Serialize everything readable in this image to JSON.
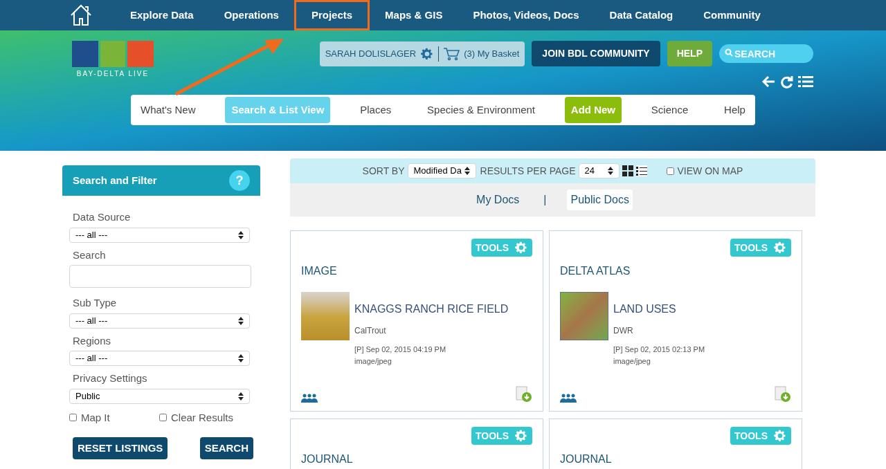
{
  "top_nav": {
    "items": [
      {
        "label": "Explore Data",
        "highlighted": false
      },
      {
        "label": "Operations",
        "highlighted": false
      },
      {
        "label": "Projects",
        "highlighted": true
      },
      {
        "label": "Maps & GIS",
        "highlighted": false
      },
      {
        "label": "Photos, Videos, Docs",
        "highlighted": false
      },
      {
        "label": "Data Catalog",
        "highlighted": false
      },
      {
        "label": "Community",
        "highlighted": false
      }
    ]
  },
  "logo": {
    "text": "BAY-DELTA LIVE"
  },
  "user_bar": {
    "user": "SARAH DOLISLAGER",
    "basket": "(3) My Basket"
  },
  "join_button": "JOIN BDL COMMUNITY",
  "help_button": "HELP",
  "search": {
    "placeholder": "SEARCH"
  },
  "sub_nav": {
    "items": [
      {
        "label": "What's New",
        "kind": "tab",
        "selected": false
      },
      {
        "label": "Search & List View",
        "kind": "tab",
        "selected": true
      },
      {
        "label": "Places",
        "kind": "tab",
        "selected": false
      },
      {
        "label": "Species & Environment",
        "kind": "tab",
        "selected": false
      },
      {
        "label": "Add New",
        "kind": "action",
        "selected": false
      },
      {
        "label": "Science",
        "kind": "tab",
        "selected": false
      },
      {
        "label": "Help",
        "kind": "tab",
        "selected": false
      }
    ]
  },
  "sidebar": {
    "title": "Search and Filter",
    "help": "?",
    "fields": [
      {
        "label": "Data Source",
        "kind": "select",
        "value": "--- all ---"
      },
      {
        "label": "Search",
        "kind": "text"
      },
      {
        "label": "Sub Type",
        "kind": "select",
        "value": "--- all ---"
      },
      {
        "label": "Regions",
        "kind": "select",
        "value": "--- all ---"
      },
      {
        "label": "Privacy Settings",
        "kind": "select",
        "value": "Public"
      }
    ],
    "checkboxes": [
      {
        "label": "Map It",
        "checked": false
      },
      {
        "label": "Clear Results",
        "checked": false
      }
    ],
    "buttons": [
      "RESET LISTINGS",
      "SEARCH"
    ]
  },
  "toolbar": {
    "sort_label": "SORT BY",
    "sort_value": "Modified Da",
    "per_page_label": "RESULTS PER PAGE",
    "per_page_value": "24",
    "map_label": "VIEW ON MAP",
    "map_checked": false
  },
  "doc_tabs": {
    "separator": "|",
    "items": [
      {
        "label": "My Docs",
        "selected": false
      },
      {
        "label": "Public Docs",
        "selected": true
      }
    ]
  },
  "cards": [
    {
      "tools": "TOOLS",
      "category": "IMAGE",
      "kind": "photo",
      "title": "KNAGGS RANCH RICE FIELD",
      "source": "CalTrout",
      "date": "[P] Sep 02, 2015 04:19 PM",
      "mime": "image/jpeg"
    },
    {
      "tools": "TOOLS",
      "category": "DELTA ATLAS",
      "kind": "map",
      "title": "LAND USES",
      "source": "DWR",
      "date": "[P] Sep 02, 2015 02:13 PM",
      "mime": "image/jpeg"
    },
    {
      "tools": "TOOLS",
      "category": "JOURNAL"
    },
    {
      "tools": "TOOLS",
      "category": "JOURNAL"
    }
  ]
}
